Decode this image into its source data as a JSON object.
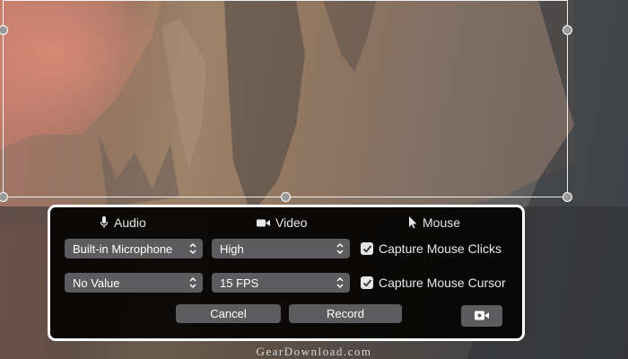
{
  "tabs": [
    {
      "label": "Audio",
      "icon": "microphone-icon"
    },
    {
      "label": "Video",
      "icon": "video-camera-icon"
    },
    {
      "label": "Mouse",
      "icon": "cursor-arrow-icon"
    }
  ],
  "audio": {
    "input_device": "Built-in Microphone",
    "setting_2": "No Value"
  },
  "video": {
    "quality": "High",
    "frame_rate": "15 FPS"
  },
  "mouse": {
    "capture_clicks": {
      "label": "Capture Mouse Clicks",
      "checked": true
    },
    "capture_cursor": {
      "label": "Capture Mouse Cursor",
      "checked": true
    }
  },
  "buttons": {
    "cancel": "Cancel",
    "record": "Record",
    "camera_icon": "video-camera-icon"
  },
  "watermark": "GearDownload.com",
  "colors": {
    "panel_bg": "#000000",
    "control_bg": "#5c5c5e",
    "text": "#ffffff"
  }
}
